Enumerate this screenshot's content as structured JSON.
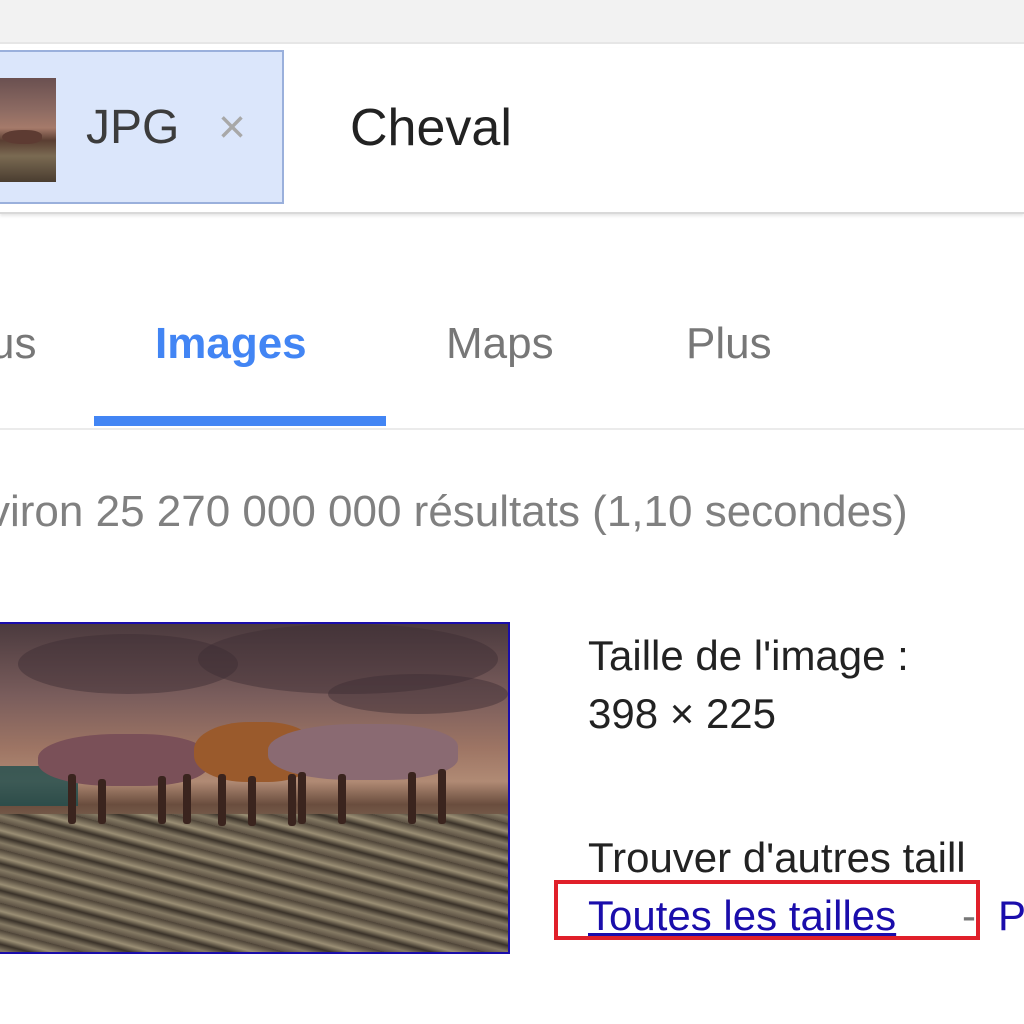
{
  "search": {
    "chip_label": "JPG",
    "chip_close": "×",
    "query": "Cheval"
  },
  "tabs": [
    {
      "label": "us",
      "active": false
    },
    {
      "label": "Images",
      "active": true
    },
    {
      "label": "Maps",
      "active": false
    },
    {
      "label": "Plus",
      "active": false
    }
  ],
  "stats": "viron 25 270 000 000 résultats (1,10 secondes)",
  "result": {
    "size_label": "Taille de l'image :",
    "size_value": "398 × 225",
    "find_other": "Trouver d'autres taill",
    "all_sizes_link": "Toutes les tailles",
    "separator": "-",
    "next_link": "P"
  },
  "colors": {
    "accent": "#4285f4",
    "link": "#1a0dab",
    "highlight": "#e0202a",
    "chip_bg": "#dbe6fb"
  }
}
